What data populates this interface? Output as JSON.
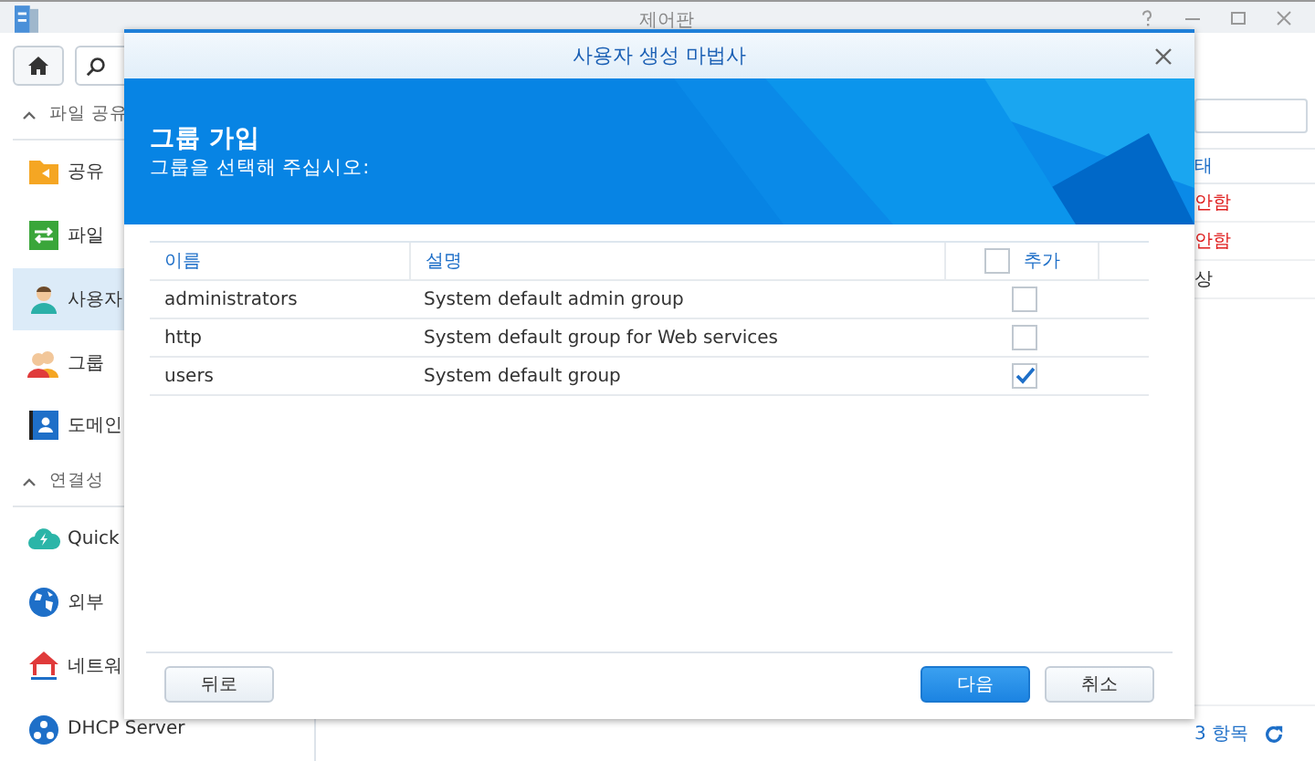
{
  "window": {
    "title": "제어판"
  },
  "sidebar": {
    "sections": [
      {
        "label": "파일 공유",
        "expanded": true,
        "items": [
          {
            "label": "공유",
            "selected": false
          },
          {
            "label": "파일",
            "selected": false
          },
          {
            "label": "사용자",
            "selected": true
          },
          {
            "label": "그룹",
            "selected": false
          },
          {
            "label": "도메인",
            "selected": false
          }
        ]
      },
      {
        "label": "연결성",
        "expanded": true,
        "items": [
          {
            "label": "Quick",
            "selected": false
          },
          {
            "label": "외부",
            "selected": false
          },
          {
            "label": "네트워",
            "selected": false
          },
          {
            "label": "DHCP Server",
            "selected": false
          }
        ]
      }
    ]
  },
  "background_table": {
    "header": "태",
    "rows": [
      {
        "text": "안함",
        "kind": "warning"
      },
      {
        "text": "안함",
        "kind": "warning"
      },
      {
        "text": "상",
        "kind": "normal"
      }
    ],
    "count": "3 항목"
  },
  "dialog": {
    "title": "사용자 생성 마법사",
    "heading": "그룹 가입",
    "subheading": "그룹을 선택해 주십시오:",
    "columns": [
      "이름",
      "설명",
      "추가"
    ],
    "select_all": false,
    "rows": [
      {
        "name": "administrators",
        "description": "System default admin group",
        "checked": false
      },
      {
        "name": "http",
        "description": "System default group for Web services",
        "checked": false
      },
      {
        "name": "users",
        "description": "System default group",
        "checked": true
      }
    ],
    "buttons": [
      {
        "label": "뒤로",
        "kind": "secondary"
      },
      {
        "label": "다음",
        "kind": "primary"
      },
      {
        "label": "취소",
        "kind": "secondary"
      }
    ]
  }
}
